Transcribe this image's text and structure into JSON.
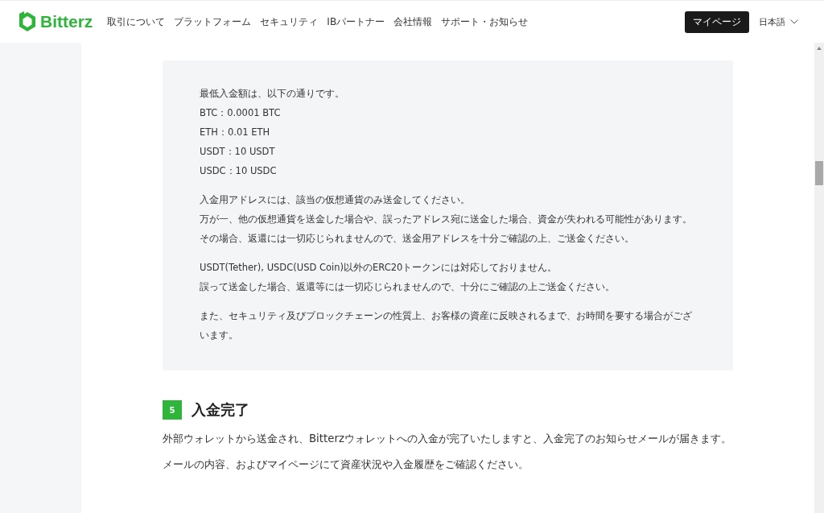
{
  "header": {
    "logo": "Bitterz",
    "nav": [
      "取引について",
      "プラットフォーム",
      "セキュリティ",
      "IBパートナー",
      "会社情報",
      "サポート・お知らせ"
    ],
    "mypage_button": "マイページ",
    "language": "日本語"
  },
  "notice": {
    "paragraphs": [
      [
        "最低入金額は、以下の通りです。",
        "BTC：0.0001 BTC",
        "ETH：0.01 ETH",
        "USDT：10 USDT",
        "USDC：10 USDC"
      ],
      [
        "入金用アドレスには、該当の仮想通貨のみ送金してください。",
        "万が一、他の仮想通貨を送金した場合や、誤ったアドレス宛に送金した場合、資金が失われる可能性があります。",
        "その場合、返還には一切応じられませんので、送金用アドレスを十分ご確認の上、ご送金ください。"
      ],
      [
        "USDT(Tether), USDC(USD Coin)以外のERC20トークンには対応しておりません。",
        "誤って送金した場合、返還等には一切応じられませんので、十分にご確認の上ご送金ください。"
      ],
      [
        "また、セキュリティ及びブロックチェーンの性質上、お客様の資産に反映されるまで、お時間を要する場合がございます。"
      ]
    ]
  },
  "step": {
    "number": "5",
    "title": "入金完了",
    "paragraphs": [
      "外部ウォレットから送金され、Bitterzウォレットへの入金が完了いたしますと、入金完了のお知らせメールが届きます。",
      "メールの内容、およびマイページにて資産状況や入金履歴をご確認ください。"
    ]
  }
}
